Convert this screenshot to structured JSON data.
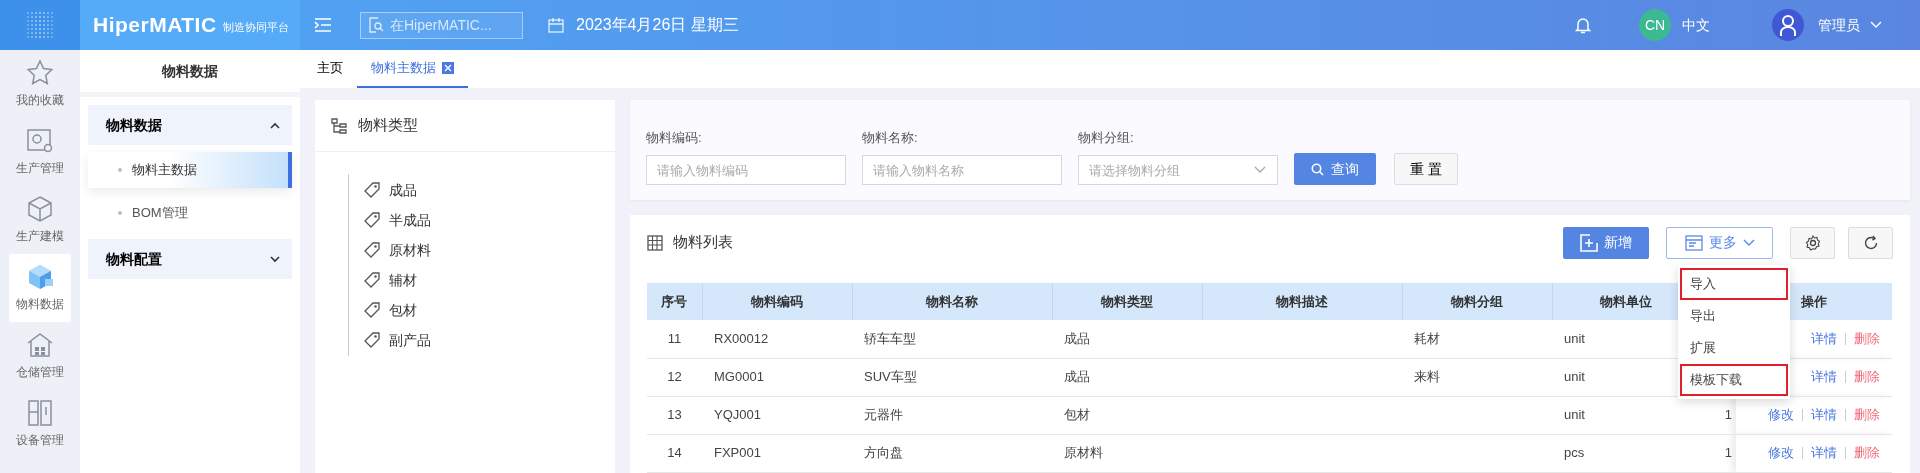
{
  "header": {
    "brand": "HiperMATIC",
    "brand_sub": "制造协同平台",
    "search": {
      "placeholder": "在HiperMATIC..."
    },
    "date": "2023年4月26日 星期三",
    "lang_badge": "CN",
    "lang": "中文",
    "user": "管理员"
  },
  "rail": [
    {
      "label": "我的收藏",
      "kind": "star",
      "selected": false
    },
    {
      "label": "生产管理",
      "kind": "monitor",
      "selected": false
    },
    {
      "label": "生产建模",
      "kind": "cube",
      "selected": false
    },
    {
      "label": "物料数据",
      "kind": "box",
      "selected": true
    },
    {
      "label": "仓储管理",
      "kind": "warehouse",
      "selected": false
    },
    {
      "label": "设备管理",
      "kind": "panels",
      "selected": false
    }
  ],
  "sidebar": {
    "title": "物料数据",
    "groups": [
      {
        "label": "物料数据",
        "expanded": true,
        "children": [
          {
            "label": "物料主数据",
            "selected": true
          },
          {
            "label": "BOM管理",
            "selected": false
          }
        ]
      },
      {
        "label": "物料配置",
        "expanded": false
      }
    ]
  },
  "tabs": [
    {
      "label": "主页",
      "selected": false,
      "closable": false
    },
    {
      "label": "物料主数据",
      "selected": true,
      "closable": true
    }
  ],
  "tree": {
    "title": "物料类型",
    "items": [
      {
        "label": "成品"
      },
      {
        "label": "半成品"
      },
      {
        "label": "原材料"
      },
      {
        "label": "辅材"
      },
      {
        "label": "包材"
      },
      {
        "label": "副产品"
      }
    ]
  },
  "filters": [
    {
      "label": "物料编码:",
      "placeholder": "请输入物料编码",
      "kind": "input"
    },
    {
      "label": "物料名称:",
      "placeholder": "请输入物料名称",
      "kind": "input"
    },
    {
      "label": "物料分组:",
      "placeholder": "请选择物料分组",
      "kind": "select"
    }
  ],
  "search_button": "查询",
  "reset_button": "重 置",
  "list": {
    "title": "物料列表",
    "add_button": "新增",
    "more_button": "更多",
    "columns": [
      "序号",
      "物料编码",
      "物料名称",
      "物料类型",
      "物料描述",
      "物料分组",
      "物料单位"
    ],
    "actions_header": "操作",
    "rows": [
      {
        "no": "11",
        "code": "RX00012",
        "name": "轿车车型",
        "type": "成品",
        "group": "耗材",
        "unit": "unit",
        "actions": [
          {
            "label": "详情",
            "kind": "view"
          },
          {
            "label": "删除",
            "kind": "delete"
          }
        ]
      },
      {
        "no": "12",
        "code": "MG0001",
        "name": "SUV车型",
        "type": "成品",
        "group": "来料",
        "unit": "unit",
        "actions": [
          {
            "label": "详情",
            "kind": "view"
          },
          {
            "label": "删除",
            "kind": "delete"
          }
        ]
      },
      {
        "no": "13",
        "code": "YQJ001",
        "name": "元器件",
        "type": "包材",
        "unit": "unit",
        "column_8": "1",
        "actions": [
          {
            "label": "修改",
            "kind": "edit"
          },
          {
            "label": "详情",
            "kind": "view"
          },
          {
            "label": "删除",
            "kind": "delete"
          }
        ]
      },
      {
        "no": "14",
        "code": "FXP001",
        "name": "方向盘",
        "type": "原材料",
        "unit": "pcs",
        "column_8": "1",
        "actions": [
          {
            "label": "修改",
            "kind": "edit"
          },
          {
            "label": "详情",
            "kind": "view"
          },
          {
            "label": "删除",
            "kind": "delete"
          }
        ]
      }
    ],
    "dropdown": [
      {
        "label": "导入",
        "highlighted": true
      },
      {
        "label": "导出",
        "highlighted": false
      },
      {
        "label": "扩展",
        "highlighted": false
      },
      {
        "label": "模板下载",
        "highlighted": true
      }
    ]
  }
}
